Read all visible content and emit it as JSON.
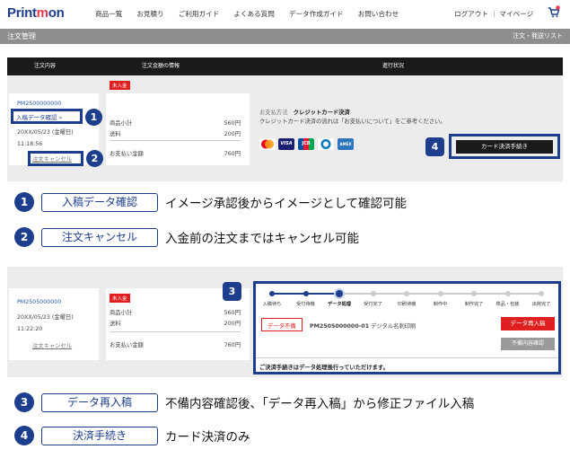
{
  "header": {
    "logo_pre": "Print",
    "logo_mark": "m",
    "logo_post": "on",
    "nav": [
      "商品一覧",
      "お見積り",
      "ご利用ガイド",
      "よくある質問",
      "データ作成ガイド",
      "お問い合わせ"
    ],
    "account": "ログアウト ｜ マイページ"
  },
  "subbar": {
    "title": "注文管理",
    "right": "注文・発送リスト"
  },
  "order1": {
    "columns": [
      "注文内容",
      "注文金額の情報",
      "進行状況"
    ],
    "order_no": "PM2500000000",
    "confirm_link": "入稿データ確認",
    "date": "20XX/05/23 (金曜日)",
    "time": "11:18:56",
    "cancel_link": "注文キャンセル",
    "status_badge": "未入金",
    "subtotal_label": "商品小計",
    "subtotal": "560円",
    "shipping_label": "送料",
    "shipping": "200円",
    "total_label": "お支払い金額",
    "total": "760円",
    "payment_method_label": "お支払方法",
    "payment_method": "クレジットカード決済",
    "payment_note": "クレジットカード決済の流れは「お支払いについて」をご参考ください。",
    "checkout_button": "カード決済手続き"
  },
  "order2": {
    "order_no": "PM2505000000",
    "date": "20XX/05/23 (金曜日)",
    "time": "11:22:20",
    "cancel_link": "注文キャンセル",
    "status_badge": "未入金",
    "subtotal_label": "商品小計",
    "subtotal": "560円",
    "shipping_label": "送料",
    "shipping": "200円",
    "total_label": "お支払い金額",
    "total": "760円",
    "steps": [
      "入稿待ち",
      "受付待機",
      "データ処理",
      "受付完了",
      "印刷待機",
      "制作中",
      "制作完了",
      "検品・包装",
      "出荷完了"
    ],
    "current_step_index": 2,
    "data_flag": "データ不備",
    "item_code": "PM2505000000-01",
    "item_name": "デジタル名刺印刷",
    "resubmit_button": "データ再入稿",
    "defect_button": "不備内容確認",
    "notice": "ご決済手続きはデータ処理後行っていただけます。"
  },
  "callouts": [
    "1",
    "2",
    "3",
    "4"
  ],
  "legend": [
    {
      "num": "1",
      "label": "入稿データ確認",
      "desc": "イメージ承認後からイメージとして確認可能"
    },
    {
      "num": "2",
      "label": "注文キャンセル",
      "desc": "入金前の注文まではキャンセル可能"
    },
    {
      "num": "3",
      "label": "データ再入稿",
      "desc": "不備内容確認後、「データ再入稿」から修正ファイル入稿"
    },
    {
      "num": "4",
      "label": "決済手続き",
      "desc": "カード決済のみ"
    }
  ],
  "payment_icons": [
    "mastercard-icon",
    "visa-icon",
    "jcb-icon",
    "diners-icon",
    "amex-icon"
  ],
  "colors": {
    "navy": "#1d3e8c",
    "red": "#e02020",
    "brand_red": "#e83a4f"
  }
}
